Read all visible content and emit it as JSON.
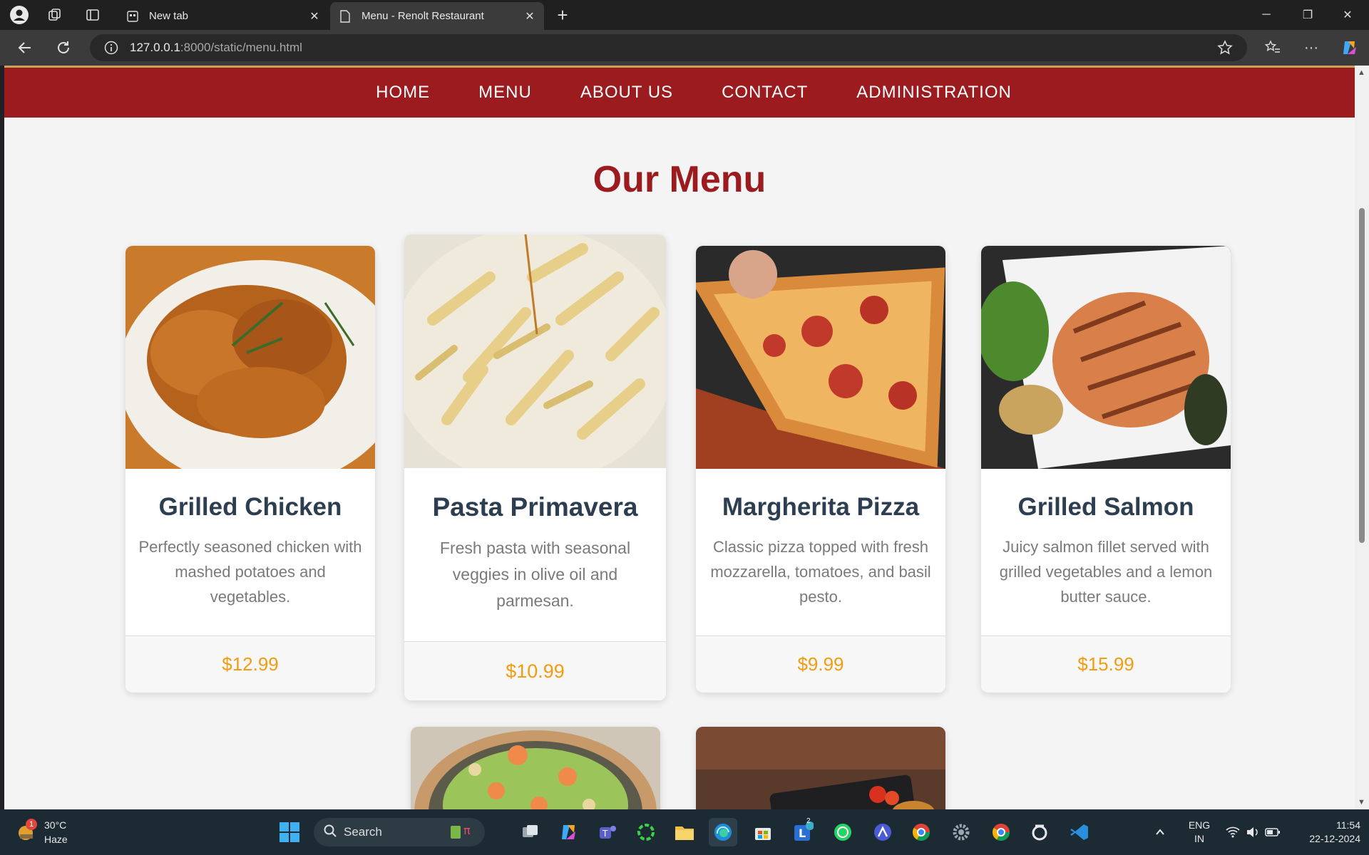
{
  "browser": {
    "tabs": [
      {
        "title": "New tab",
        "active": false
      },
      {
        "title": "Menu - Renolt Restaurant",
        "active": true
      }
    ],
    "url_host": "127.0.0.1",
    "url_rest": ":8000/static/menu.html"
  },
  "site": {
    "nav": [
      "HOME",
      "MENU",
      "ABOUT US",
      "CONTACT",
      "ADMINISTRATION"
    ],
    "heading": "Our Menu",
    "items": [
      {
        "name": "Grilled Chicken",
        "description": "Perfectly seasoned chicken with mashed potatoes and vegetables.",
        "price": "$12.99",
        "image": "grilled-chicken-photo"
      },
      {
        "name": "Pasta Primavera",
        "description": "Fresh pasta with seasonal veggies in olive oil and parmesan.",
        "price": "$10.99",
        "image": "pasta-photo"
      },
      {
        "name": "Margherita Pizza",
        "description": "Classic pizza topped with fresh mozzarella, tomatoes, and basil pesto.",
        "price": "$9.99",
        "image": "pizza-photo"
      },
      {
        "name": "Grilled Salmon",
        "description": "Juicy salmon fillet served with grilled vegetables and a lemon butter sauce.",
        "price": "$15.99",
        "image": "salmon-photo"
      }
    ],
    "colors": {
      "brand": "#9b1b1e",
      "price": "#f39c12",
      "item_title": "#2c3e50"
    }
  },
  "taskbar": {
    "weather_temp": "30°C",
    "weather_desc": "Haze",
    "weather_badge": "1",
    "search_label": "Search",
    "lang_top": "ENG",
    "lang_bottom": "IN",
    "time": "11:54",
    "date": "22-12-2024",
    "teams_badge": "2"
  }
}
